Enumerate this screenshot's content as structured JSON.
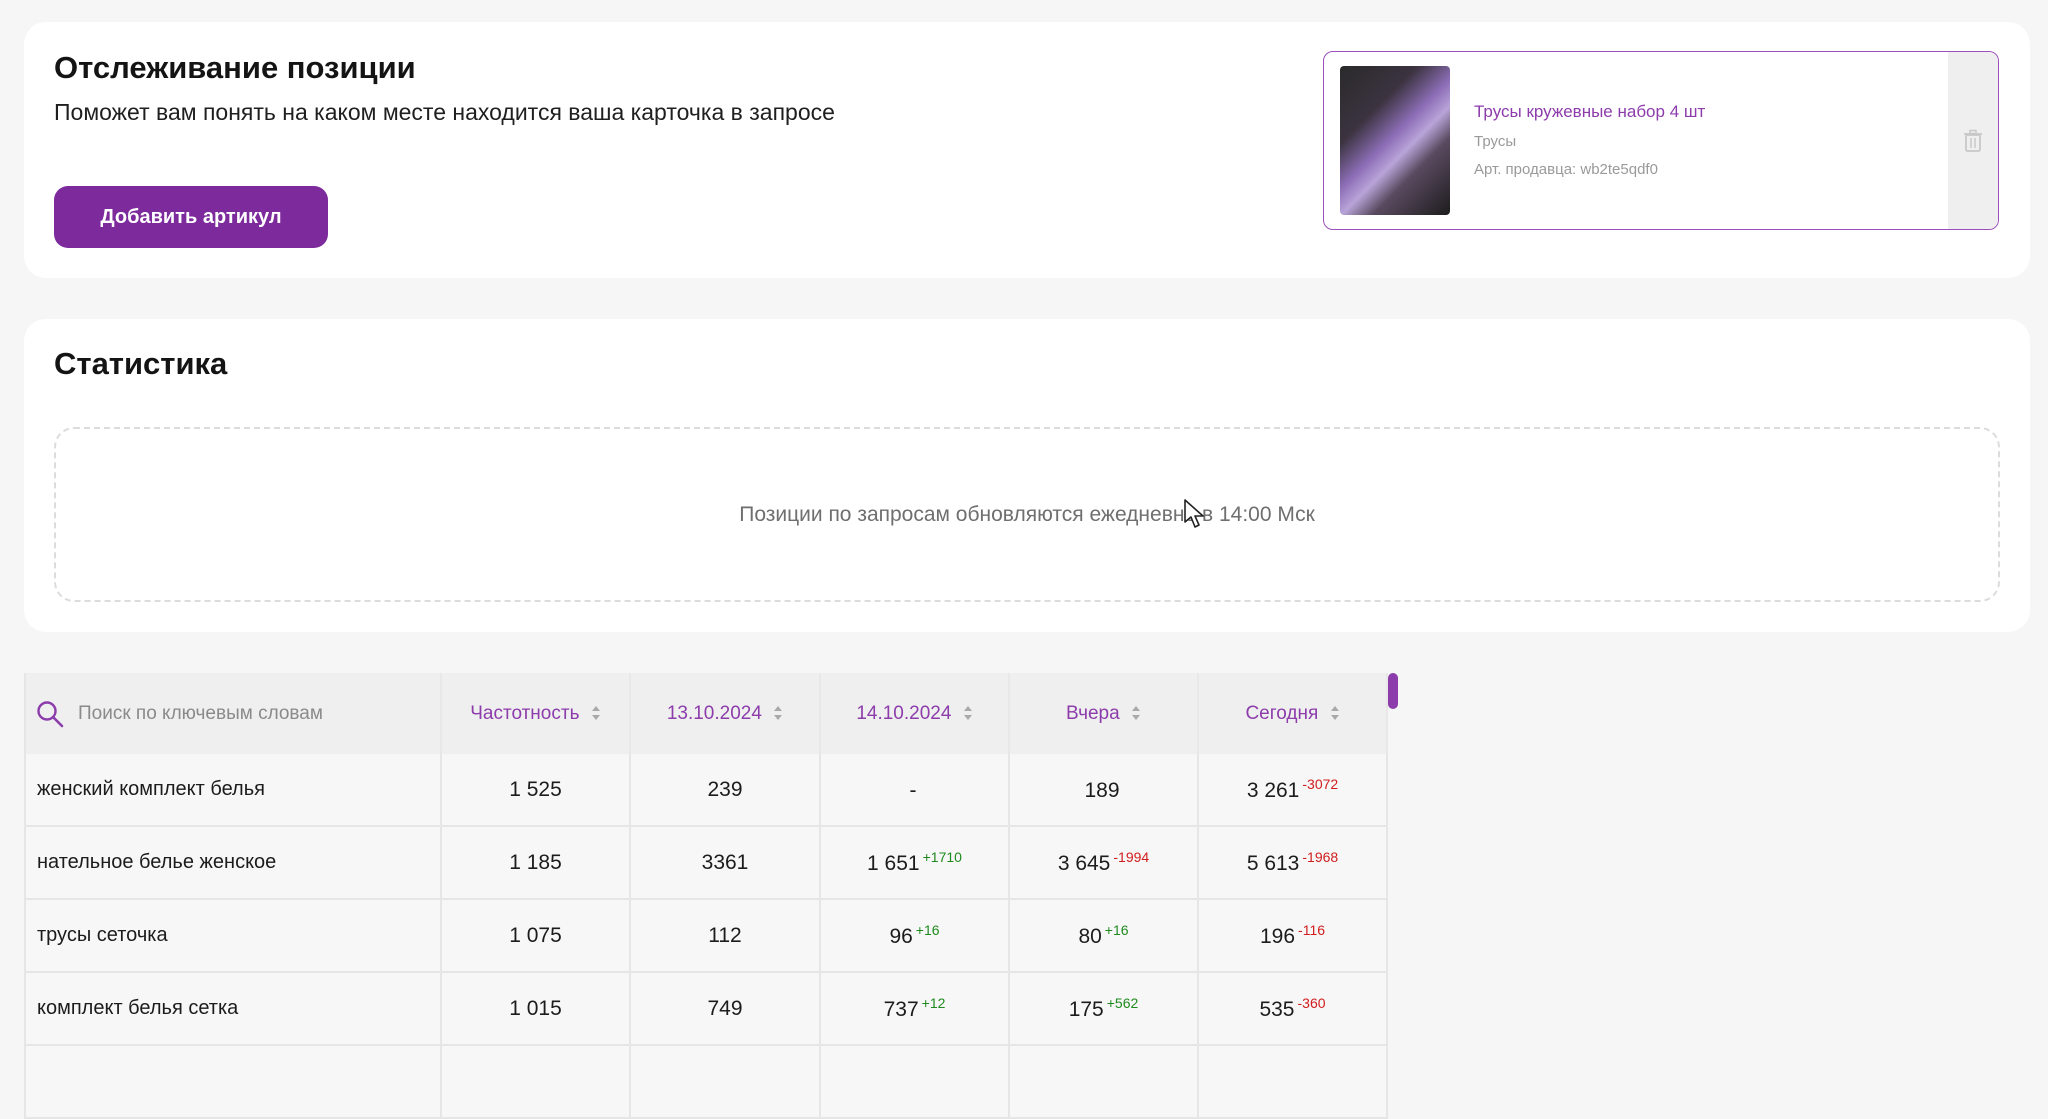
{
  "tracking": {
    "title": "Отслеживание позиции",
    "subtitle": "Поможет вам понять на каком месте находится ваша карточка в запросе",
    "add_button": "Добавить артикул",
    "product": {
      "title": "Трусы кружевные набор 4 шт",
      "category": "Трусы",
      "sku": "Арт. продавца: wb2te5qdf0"
    }
  },
  "stats": {
    "title": "Статистика",
    "notice": "Позиции по запросам обновляются ежедневно в 14:00 Мск"
  },
  "table": {
    "search_placeholder": "Поиск по ключевым словам",
    "headers": {
      "frequency": "Частотность",
      "d1": "13.10.2024",
      "d2": "14.10.2024",
      "yesterday": "Вчера",
      "today": "Сегодня"
    },
    "rows": [
      {
        "keyword": "женский комплект белья",
        "frequency": "1 525",
        "d1": "239",
        "d2": "-",
        "d2_delta": "",
        "yesterday": "189",
        "yesterday_delta": "",
        "today": "3 261",
        "today_delta": "-3072"
      },
      {
        "keyword": "нательное белье женское",
        "frequency": "1 185",
        "d1": "3361",
        "d2": "1 651",
        "d2_delta": "+1710",
        "yesterday": "3 645",
        "yesterday_delta": "-1994",
        "today": "5 613",
        "today_delta": "-1968"
      },
      {
        "keyword": "трусы сеточка",
        "frequency": "1 075",
        "d1": "112",
        "d2": "96",
        "d2_delta": "+16",
        "yesterday": "80",
        "yesterday_delta": "+16",
        "today": "196",
        "today_delta": "-116"
      },
      {
        "keyword": "комплект белья сетка",
        "frequency": "1 015",
        "d1": "749",
        "d2": "737",
        "d2_delta": "+12",
        "yesterday": "175",
        "yesterday_delta": "+562",
        "today": "535",
        "today_delta": "-360"
      }
    ]
  },
  "colors": {
    "accent": "#7d2a9d",
    "header_text": "#8c3cab",
    "negative": "#d11d1d",
    "positive": "#1e8a1e"
  },
  "icons": [
    "trash-icon",
    "search-icon",
    "sort-icon",
    "mouse-cursor-icon"
  ]
}
